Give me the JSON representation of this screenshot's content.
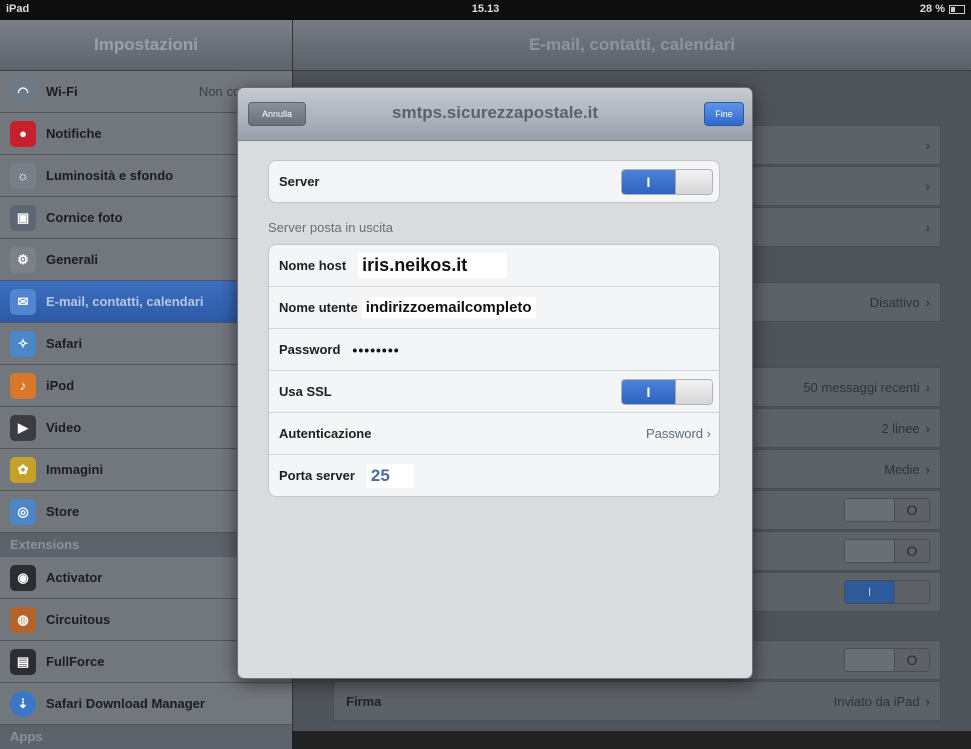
{
  "status": {
    "device": "iPad",
    "time": "15.13",
    "battery": "28 %"
  },
  "sidebar": {
    "title": "Impostazioni",
    "wifi_value": "Non connesso",
    "items": [
      {
        "label": "Wi-Fi",
        "icon": "wifi-icon",
        "color": "#6d7a86"
      },
      {
        "label": "Notifiche",
        "icon": "notifications-icon",
        "color": "#c8202a"
      },
      {
        "label": "Luminosità e sfondo",
        "icon": "brightness-icon",
        "color": "#7a7f87"
      },
      {
        "label": "Cornice foto",
        "icon": "picture-frame-icon",
        "color": "#5e6672"
      },
      {
        "label": "Generali",
        "icon": "gear-icon",
        "color": "#7b8089"
      },
      {
        "label": "E-mail, contatti, calendari",
        "icon": "mail-icon",
        "color": "#4f86cf"
      },
      {
        "label": "Safari",
        "icon": "safari-icon",
        "color": "#4a86c8"
      },
      {
        "label": "iPod",
        "icon": "ipod-icon",
        "color": "#d9782a"
      },
      {
        "label": "Video",
        "icon": "video-icon",
        "color": "#3a3c40"
      },
      {
        "label": "Immagini",
        "icon": "sunflower-icon",
        "color": "#c6a12a"
      },
      {
        "label": "Store",
        "icon": "store-icon",
        "color": "#4c86c7"
      }
    ],
    "section_extensions": "Extensions",
    "ext_items": [
      {
        "label": "Activator",
        "icon": "activator-icon",
        "color": "#2b2d31"
      },
      {
        "label": "Circuitous",
        "icon": "circuitous-icon",
        "color": "#b4642a"
      },
      {
        "label": "FullForce",
        "icon": "fullforce-icon",
        "color": "#2b2d31"
      },
      {
        "label": "Safari Download Manager",
        "icon": "download-manager-icon",
        "color": "#3a77c6"
      }
    ],
    "section_apps": "Apps"
  },
  "main": {
    "title": "E-mail, contatti, calendari",
    "rows": {
      "disattivo": "Disattivo",
      "recent": "50 messaggi recenti",
      "lines": "2 linee",
      "size": "Medie",
      "firma_label": "Firma",
      "firma_value": "Inviato da iPad"
    }
  },
  "modal": {
    "title": "smtps.sicurezzapostale.it",
    "cancel": "Annulla",
    "done": "Fine",
    "server_label": "Server",
    "section_header": "Server posta in uscita",
    "host_label": "Nome host",
    "host_value": "iris.neikos.it",
    "user_label": "Nome utente",
    "user_value": "indirizzoemailcompleto",
    "password_label": "Password",
    "password_value": "••••••••",
    "ssl_label": "Usa SSL",
    "auth_label": "Autenticazione",
    "auth_value": "Password",
    "port_label": "Porta server",
    "port_value": "25",
    "toggle_on": "I",
    "toggle_off": "O"
  },
  "colors": {
    "accent": "#2e63c0",
    "selected_row": "#3c6fc0"
  }
}
